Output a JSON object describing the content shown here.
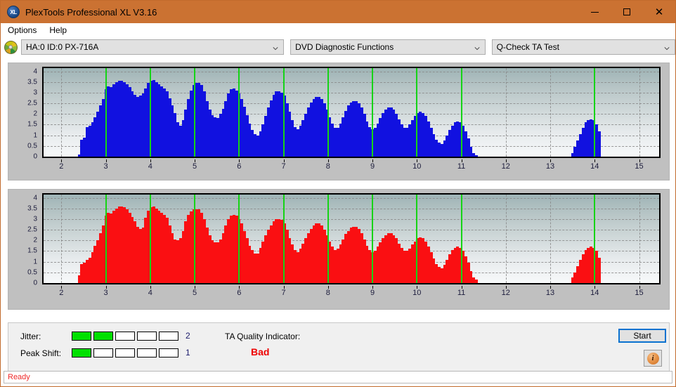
{
  "window": {
    "title": "PlexTools Professional XL V3.16",
    "icon": "XL",
    "accent_color": "#cb7232",
    "controls": {
      "minimize": "minimize-icon",
      "maximize": "maximize-icon",
      "close": "close-icon"
    }
  },
  "menu": {
    "items": [
      "Options",
      "Help"
    ]
  },
  "toolbar": {
    "drive_selector": {
      "value": "HA:0 ID:0  PX-716A",
      "icon": "disc-icon"
    },
    "function_selector": {
      "value": "DVD Diagnostic Functions"
    },
    "test_selector": {
      "value": "Q-Check TA Test"
    }
  },
  "results": {
    "jitter_label": "Jitter:",
    "jitter_value": "2",
    "jitter_filled": 2,
    "jitter_cells": 5,
    "peak_shift_label": "Peak Shift:",
    "peak_shift_value": "1",
    "peak_shift_filled": 1,
    "peak_shift_cells": 5,
    "quality_label": "TA Quality Indicator:",
    "quality_value": "Bad",
    "quality_color": "#ee0000",
    "start_label": "Start",
    "info_label": "i"
  },
  "statusbar": {
    "text": "Ready"
  },
  "chart_data": [
    {
      "id": "ta-test-jitter-top",
      "type": "bar",
      "title": "",
      "xlabel": "",
      "ylabel": "",
      "series_color": "#1111e0",
      "marker_color": "#16d316",
      "xlim": [
        1.6,
        15.45
      ],
      "ylim": [
        0,
        4.15
      ],
      "xticks": [
        2,
        3,
        4,
        5,
        6,
        7,
        8,
        9,
        10,
        11,
        12,
        13,
        14,
        15
      ],
      "yticks": [
        0,
        0.5,
        1,
        1.5,
        2,
        2.5,
        3,
        3.5,
        4
      ],
      "ytick_labels": [
        "0",
        "0.5",
        "1",
        "1.5",
        "2",
        "2.5",
        "3",
        "3.5",
        "4"
      ],
      "grid": true,
      "markers": [
        3,
        4,
        5,
        6,
        7,
        8,
        9,
        10,
        11,
        14
      ],
      "x": [
        2.4,
        2.46,
        2.52,
        2.58,
        2.64,
        2.7,
        2.76,
        2.82,
        2.88,
        2.94,
        3.0,
        3.06,
        3.12,
        3.18,
        3.24,
        3.3,
        3.36,
        3.42,
        3.48,
        3.54,
        3.6,
        3.66,
        3.72,
        3.78,
        3.84,
        3.9,
        3.96,
        4.02,
        4.08,
        4.14,
        4.2,
        4.26,
        4.32,
        4.38,
        4.44,
        4.5,
        4.56,
        4.62,
        4.68,
        4.74,
        4.8,
        4.86,
        4.92,
        4.98,
        5.04,
        5.1,
        5.16,
        5.22,
        5.28,
        5.34,
        5.4,
        5.46,
        5.52,
        5.58,
        5.64,
        5.7,
        5.76,
        5.82,
        5.88,
        5.94,
        6.0,
        6.06,
        6.12,
        6.18,
        6.24,
        6.3,
        6.36,
        6.42,
        6.48,
        6.54,
        6.6,
        6.66,
        6.72,
        6.78,
        6.84,
        6.9,
        6.96,
        7.02,
        7.08,
        7.14,
        7.2,
        7.26,
        7.32,
        7.38,
        7.44,
        7.5,
        7.56,
        7.62,
        7.68,
        7.74,
        7.8,
        7.86,
        7.92,
        7.98,
        8.04,
        8.1,
        8.16,
        8.22,
        8.28,
        8.34,
        8.4,
        8.46,
        8.52,
        8.58,
        8.64,
        8.7,
        8.76,
        8.82,
        8.88,
        8.94,
        9.0,
        9.06,
        9.12,
        9.18,
        9.24,
        9.3,
        9.36,
        9.42,
        9.48,
        9.54,
        9.6,
        9.66,
        9.72,
        9.78,
        9.84,
        9.9,
        9.96,
        10.02,
        10.08,
        10.14,
        10.2,
        10.26,
        10.32,
        10.38,
        10.44,
        10.5,
        10.56,
        10.62,
        10.68,
        10.74,
        10.8,
        10.86,
        10.92,
        10.98,
        11.04,
        11.1,
        11.16,
        11.22,
        11.28,
        11.34,
        13.5,
        13.56,
        13.62,
        13.68,
        13.74,
        13.8,
        13.86,
        13.92,
        13.98,
        14.04,
        14.1
      ],
      "values": [
        0.1,
        0.8,
        0.9,
        1.4,
        1.45,
        1.6,
        1.85,
        2.1,
        2.4,
        2.7,
        3.15,
        3.3,
        3.25,
        3.4,
        3.5,
        3.55,
        3.55,
        3.5,
        3.4,
        3.25,
        3.05,
        2.9,
        2.8,
        2.85,
        2.95,
        3.2,
        3.45,
        3.55,
        3.6,
        3.5,
        3.4,
        3.3,
        3.2,
        3.05,
        2.75,
        2.4,
        2.05,
        1.6,
        1.45,
        1.7,
        2.2,
        2.7,
        3.1,
        3.35,
        3.45,
        3.45,
        3.35,
        3.05,
        2.6,
        2.2,
        1.95,
        1.85,
        1.8,
        2.0,
        2.25,
        2.6,
        2.95,
        3.15,
        3.2,
        3.1,
        2.95,
        2.7,
        2.35,
        1.95,
        1.55,
        1.25,
        1.05,
        1.0,
        1.2,
        1.5,
        1.9,
        2.3,
        2.65,
        2.9,
        3.05,
        3.05,
        3.0,
        2.85,
        2.5,
        2.1,
        1.7,
        1.4,
        1.3,
        1.45,
        1.7,
        2.0,
        2.3,
        2.55,
        2.7,
        2.8,
        2.8,
        2.7,
        2.5,
        2.2,
        1.85,
        1.55,
        1.35,
        1.35,
        1.55,
        1.85,
        2.15,
        2.4,
        2.55,
        2.6,
        2.6,
        2.5,
        2.3,
        2.0,
        1.65,
        1.4,
        1.3,
        1.35,
        1.55,
        1.8,
        2.05,
        2.2,
        2.3,
        2.3,
        2.2,
        2.0,
        1.75,
        1.5,
        1.35,
        1.35,
        1.5,
        1.7,
        1.9,
        2.05,
        2.1,
        2.05,
        1.9,
        1.65,
        1.35,
        1.05,
        0.8,
        0.65,
        0.6,
        0.75,
        1.0,
        1.25,
        1.45,
        1.6,
        1.65,
        1.6,
        1.45,
        1.2,
        0.85,
        0.45,
        0.15,
        0.08,
        0.15,
        0.45,
        0.75,
        1.05,
        1.35,
        1.6,
        1.7,
        1.75,
        1.7,
        1.5,
        1.2,
        0.85
      ]
    },
    {
      "id": "ta-test-asymmetry-bottom",
      "type": "bar",
      "title": "",
      "xlabel": "",
      "ylabel": "",
      "series_color": "#fa0f12",
      "marker_color": "#16d316",
      "xlim": [
        1.6,
        15.45
      ],
      "ylim": [
        0,
        4.15
      ],
      "xticks": [
        2,
        3,
        4,
        5,
        6,
        7,
        8,
        9,
        10,
        11,
        12,
        13,
        14,
        15
      ],
      "yticks": [
        0,
        0.5,
        1,
        1.5,
        2,
        2.5,
        3,
        3.5,
        4
      ],
      "ytick_labels": [
        "0",
        "0.5",
        "1",
        "1.5",
        "2",
        "2.5",
        "3",
        "3.5",
        "4"
      ],
      "grid": true,
      "markers": [
        3,
        4,
        5,
        6,
        7,
        8,
        9,
        10,
        11,
        14
      ],
      "x": [
        2.4,
        2.46,
        2.52,
        2.58,
        2.64,
        2.7,
        2.76,
        2.82,
        2.88,
        2.94,
        3.0,
        3.06,
        3.12,
        3.18,
        3.24,
        3.3,
        3.36,
        3.42,
        3.48,
        3.54,
        3.6,
        3.66,
        3.72,
        3.78,
        3.84,
        3.9,
        3.96,
        4.02,
        4.08,
        4.14,
        4.2,
        4.26,
        4.32,
        4.38,
        4.44,
        4.5,
        4.56,
        4.62,
        4.68,
        4.74,
        4.8,
        4.86,
        4.92,
        4.98,
        5.04,
        5.1,
        5.16,
        5.22,
        5.28,
        5.34,
        5.4,
        5.46,
        5.52,
        5.58,
        5.64,
        5.7,
        5.76,
        5.82,
        5.88,
        5.94,
        6.0,
        6.06,
        6.12,
        6.18,
        6.24,
        6.3,
        6.36,
        6.42,
        6.48,
        6.54,
        6.6,
        6.66,
        6.72,
        6.78,
        6.84,
        6.9,
        6.96,
        7.02,
        7.08,
        7.14,
        7.2,
        7.26,
        7.32,
        7.38,
        7.44,
        7.5,
        7.56,
        7.62,
        7.68,
        7.74,
        7.8,
        7.86,
        7.92,
        7.98,
        8.04,
        8.1,
        8.16,
        8.22,
        8.28,
        8.34,
        8.4,
        8.46,
        8.52,
        8.58,
        8.64,
        8.7,
        8.76,
        8.82,
        8.88,
        8.94,
        9.0,
        9.06,
        9.12,
        9.18,
        9.24,
        9.3,
        9.36,
        9.42,
        9.48,
        9.54,
        9.6,
        9.66,
        9.72,
        9.78,
        9.84,
        9.9,
        9.96,
        10.02,
        10.08,
        10.14,
        10.2,
        10.26,
        10.32,
        10.38,
        10.44,
        10.5,
        10.56,
        10.62,
        10.68,
        10.74,
        10.8,
        10.86,
        10.92,
        10.98,
        11.04,
        11.1,
        11.16,
        11.22,
        11.28,
        11.34,
        13.5,
        13.56,
        13.62,
        13.68,
        13.74,
        13.8,
        13.86,
        13.92,
        13.98,
        14.04,
        14.1
      ],
      "values": [
        0.35,
        0.9,
        0.95,
        1.1,
        1.2,
        1.45,
        1.75,
        2.0,
        2.35,
        2.7,
        3.15,
        3.3,
        3.25,
        3.4,
        3.5,
        3.6,
        3.6,
        3.55,
        3.45,
        3.3,
        3.1,
        2.9,
        2.65,
        2.55,
        2.6,
        3.05,
        3.4,
        3.55,
        3.6,
        3.5,
        3.4,
        3.3,
        3.2,
        3.05,
        2.7,
        2.35,
        2.05,
        2.0,
        2.1,
        2.45,
        2.9,
        3.2,
        3.35,
        3.45,
        3.45,
        3.45,
        3.3,
        3.0,
        2.6,
        2.25,
        2.0,
        1.9,
        1.9,
        2.05,
        2.35,
        2.7,
        3.0,
        3.15,
        3.2,
        3.15,
        3.0,
        2.8,
        2.45,
        2.1,
        1.75,
        1.55,
        1.4,
        1.4,
        1.65,
        1.95,
        2.25,
        2.5,
        2.7,
        2.9,
        3.0,
        3.0,
        2.95,
        2.8,
        2.5,
        2.1,
        1.8,
        1.55,
        1.45,
        1.6,
        1.85,
        2.1,
        2.35,
        2.55,
        2.7,
        2.8,
        2.8,
        2.7,
        2.5,
        2.25,
        1.95,
        1.7,
        1.55,
        1.6,
        1.8,
        2.05,
        2.3,
        2.45,
        2.6,
        2.65,
        2.65,
        2.55,
        2.35,
        2.05,
        1.75,
        1.55,
        1.45,
        1.5,
        1.7,
        1.9,
        2.1,
        2.25,
        2.35,
        2.35,
        2.25,
        2.1,
        1.85,
        1.65,
        1.5,
        1.5,
        1.6,
        1.8,
        1.95,
        2.1,
        2.15,
        2.1,
        1.95,
        1.7,
        1.45,
        1.15,
        0.9,
        0.75,
        0.7,
        0.85,
        1.1,
        1.35,
        1.55,
        1.65,
        1.7,
        1.65,
        1.5,
        1.25,
        0.95,
        0.55,
        0.25,
        0.15,
        0.25,
        0.5,
        0.8,
        1.1,
        1.35,
        1.55,
        1.65,
        1.7,
        1.65,
        1.5,
        1.2,
        0.85
      ]
    }
  ]
}
